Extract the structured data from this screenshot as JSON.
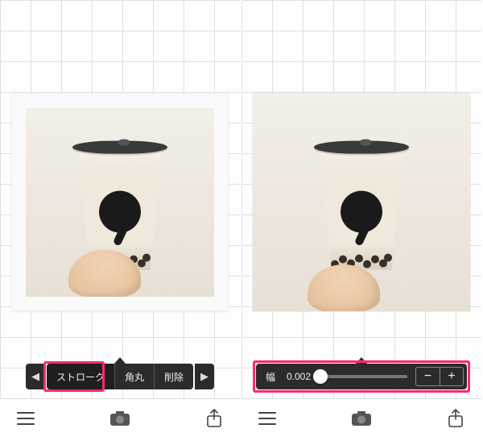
{
  "left": {
    "segmented": {
      "prev_glyph": "◀",
      "next_glyph": "▶",
      "items": [
        {
          "label": "ストローク",
          "selected": true
        },
        {
          "label": "角丸",
          "selected": false
        },
        {
          "label": "削除",
          "selected": false
        }
      ]
    }
  },
  "right": {
    "slider": {
      "label": "幅",
      "value": "0.002",
      "minus": "−",
      "plus": "+"
    }
  },
  "bottombar": {
    "menu": "menu",
    "camera": "camera",
    "share": "share"
  }
}
